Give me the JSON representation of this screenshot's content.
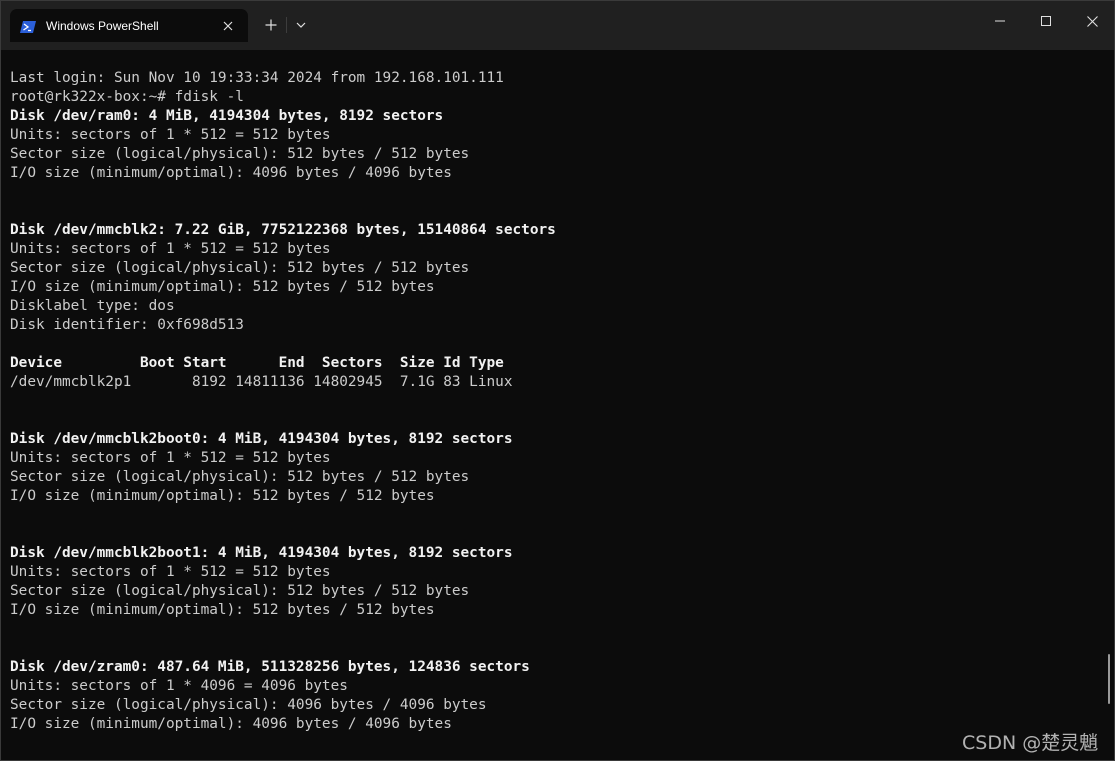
{
  "window": {
    "tab_title": "Windows PowerShell",
    "icons": {
      "tab": "powershell-icon",
      "close_tab": "close-icon",
      "new_tab": "plus-icon",
      "dropdown": "chevron-down-icon",
      "minimize": "minimize-icon",
      "maximize": "maximize-icon",
      "close": "close-icon"
    },
    "colors": {
      "titlebar": "#202020",
      "terminal_bg": "#0c0c0c",
      "text": "#cccccc",
      "bold_text": "#f2f2f2",
      "accent": "#2b5fd9"
    }
  },
  "terminal": {
    "lines": [
      {
        "text": "Last login: Sun Nov 10 19:33:34 2024 from 192.168.101.111",
        "bold": false
      },
      {
        "text": "root@rk322x-box:~# fdisk -l",
        "bold": false
      },
      {
        "text": "Disk /dev/ram0: 4 MiB, 4194304 bytes, 8192 sectors",
        "bold": true
      },
      {
        "text": "Units: sectors of 1 * 512 = 512 bytes",
        "bold": false
      },
      {
        "text": "Sector size (logical/physical): 512 bytes / 512 bytes",
        "bold": false
      },
      {
        "text": "I/O size (minimum/optimal): 4096 bytes / 4096 bytes",
        "bold": false
      },
      {
        "text": "",
        "bold": false
      },
      {
        "text": "",
        "bold": false
      },
      {
        "text": "Disk /dev/mmcblk2: 7.22 GiB, 7752122368 bytes, 15140864 sectors",
        "bold": true
      },
      {
        "text": "Units: sectors of 1 * 512 = 512 bytes",
        "bold": false
      },
      {
        "text": "Sector size (logical/physical): 512 bytes / 512 bytes",
        "bold": false
      },
      {
        "text": "I/O size (minimum/optimal): 512 bytes / 512 bytes",
        "bold": false
      },
      {
        "text": "Disklabel type: dos",
        "bold": false
      },
      {
        "text": "Disk identifier: 0xf698d513",
        "bold": false
      },
      {
        "text": "",
        "bold": false
      },
      {
        "text": "Device         Boot Start      End  Sectors  Size Id Type",
        "bold": true
      },
      {
        "text": "/dev/mmcblk2p1       8192 14811136 14802945  7.1G 83 Linux",
        "bold": false
      },
      {
        "text": "",
        "bold": false
      },
      {
        "text": "",
        "bold": false
      },
      {
        "text": "Disk /dev/mmcblk2boot0: 4 MiB, 4194304 bytes, 8192 sectors",
        "bold": true
      },
      {
        "text": "Units: sectors of 1 * 512 = 512 bytes",
        "bold": false
      },
      {
        "text": "Sector size (logical/physical): 512 bytes / 512 bytes",
        "bold": false
      },
      {
        "text": "I/O size (minimum/optimal): 512 bytes / 512 bytes",
        "bold": false
      },
      {
        "text": "",
        "bold": false
      },
      {
        "text": "",
        "bold": false
      },
      {
        "text": "Disk /dev/mmcblk2boot1: 4 MiB, 4194304 bytes, 8192 sectors",
        "bold": true
      },
      {
        "text": "Units: sectors of 1 * 512 = 512 bytes",
        "bold": false
      },
      {
        "text": "Sector size (logical/physical): 512 bytes / 512 bytes",
        "bold": false
      },
      {
        "text": "I/O size (minimum/optimal): 512 bytes / 512 bytes",
        "bold": false
      },
      {
        "text": "",
        "bold": false
      },
      {
        "text": "",
        "bold": false
      },
      {
        "text": "Disk /dev/zram0: 487.64 MiB, 511328256 bytes, 124836 sectors",
        "bold": true
      },
      {
        "text": "Units: sectors of 1 * 4096 = 4096 bytes",
        "bold": false
      },
      {
        "text": "Sector size (logical/physical): 4096 bytes / 4096 bytes",
        "bold": false
      },
      {
        "text": "I/O size (minimum/optimal): 4096 bytes / 4096 bytes",
        "bold": false
      }
    ]
  },
  "watermark": "CSDN @楚灵魈"
}
